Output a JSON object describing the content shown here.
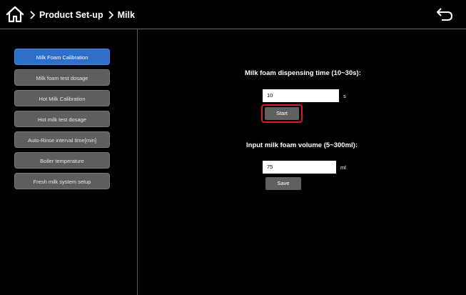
{
  "header": {
    "breadcrumb": [
      "Product Set-up",
      "Milk"
    ]
  },
  "sidebar": {
    "items": [
      {
        "label": "Milk Foam Calibration",
        "active": true
      },
      {
        "label": "Milk foam test dosage",
        "active": false
      },
      {
        "label": "Hot Milk Calibration",
        "active": false
      },
      {
        "label": "Hot milk test dosage",
        "active": false
      },
      {
        "label": "Auto-Rinse interval time[min]",
        "active": false
      },
      {
        "label": "Boiler temperature",
        "active": false
      },
      {
        "label": "Fresh milk system setup",
        "active": false
      }
    ]
  },
  "main": {
    "dispensing": {
      "label": "Milk foam dispensing time (10~30s):",
      "value": "10",
      "unit": "s",
      "button": "Start"
    },
    "volume": {
      "label": "Input  milk foam volume (5~300ml):",
      "value": "75",
      "unit": "ml",
      "button": "Save"
    }
  },
  "colors": {
    "background": "#000000",
    "active_item": "#2f6fc9",
    "button": "#606060",
    "highlight": "#d42020"
  },
  "icons": {
    "home": "home-icon",
    "back": "back-arrow-icon",
    "separator": "chevron-right-icon"
  }
}
